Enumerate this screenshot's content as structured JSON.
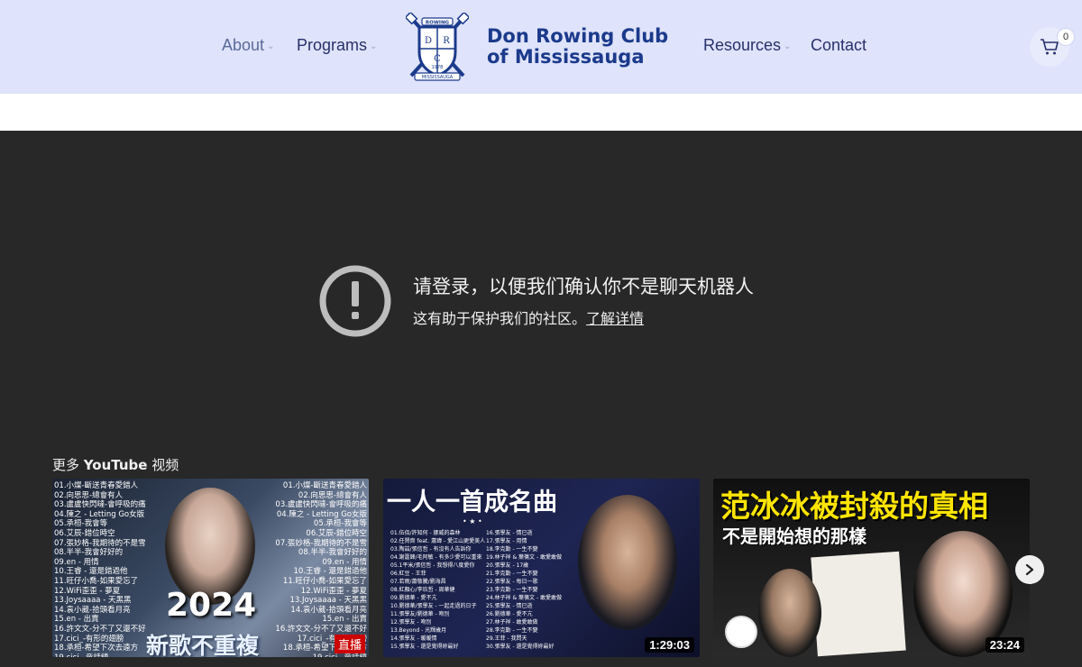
{
  "nav": {
    "about": "About",
    "programs": "Programs",
    "resources": "Resources",
    "contact": "Contact",
    "logo_line1": "Don Rowing Club",
    "logo_line2": "of Mississauga",
    "crest_top": "ROWING",
    "crest_bottom": "MISSISSAUGA",
    "crest_year": "1978",
    "crest_letters": [
      "D",
      "R",
      "C"
    ],
    "cart_count": "0"
  },
  "video": {
    "alert_title": "请登录，以便我们确认你不是聊天机器人",
    "alert_sub": "这有助于保护我们的社区。",
    "alert_link": "了解详情",
    "more_prefix": "更多 ",
    "more_brand": "YouTube",
    "more_suffix": " 视频",
    "thumbs": [
      {
        "tracks_left": "01.小燦-斷送青春愛錯人\n02.向思思-總會有人\n03.盧盧快閃噠-會呼吸的痛\n04.陳之 - Letting Go女版\n05.承桓-我會等\n06.艾辰-錯位時空\n07.張妙格-我期待的不是雪\n08.半半-我會好好的\n09.en - 用情\n10.王睿 - 還是錯過他\n11.旺仔小喬-如果愛忘了\n12.WiFi歪歪 - 夢夏\n13.Joysaaaa - 天黑黑\n14.袁小葳-拾頭看月亮\n15.en - 出賣\n16.許文文-分不了又還不好\n17.cici_-有形的翅膀\n18.承桓-希望下次去遠方\n19.cici_-童話鎮\n20.下圍,路口",
        "tracks_right": "01.小燦-斷送青春愛錯人\n02.向思思-總會有人\n03.盧盧快閃噠-會呼吸的痛\n04.陳之 - Letting Go女版\n05.承桓-我會等\n06.艾辰-錯位時空\n07.張妙格-我期待的不是雪\n08.半半-我會好好的\n09.en - 用情\n10.王睿 - 還是錯過他\n11.旺仔小喬-如果愛忘了\n12.WiFi歪歪 - 夢夏\n13.Joysaaaa - 天黑黑\n14.袁小葳-拾頭看月亮\n15.en - 出賣\n16.許文文-分不了又還不好\n17.cici_-有形的翅膀\n18.承桓-希望下次去遠方\n19.cici_-童話鎮\n20.下圍,路口",
        "year": "2024",
        "caption": "新歌不重複",
        "badge": "直播"
      },
      {
        "title": "一人一首成名曲",
        "tracks_a": "01.伍佰/許知何 - 挪威的森林\n02.任賢齊 feat. 蕭瑋 - 愛江山更愛美人\n03.陶喆/張信哲 - 有沒有人告訴你\n04.謝霆鋒/毛阿敏 - 有多少愛可以重來\n05.1平米/張信哲 - 我想得八度愛你\n06.紅豆 - 王菲\n07.若雨/蕭敬騰/劉海昌\n08.紅顏心/李玖哲 - 周華健\n09.劉德華 - 愛不亢\n10.劉德華/張學友 - 一起走過的日子\n11.張學友/劉德華 - 吻別\n12.張學友 - 吻別\n13.Beyond - 光輝歲月\n14.張學友 - 暖暖情\n15.張學友 - 還是覺得妳最好",
        "tracks_b": "16.張學友 - 情已逝\n17.張學友 - 用情\n18.李克勤 - 一生不變\n19.林子祥 & 葉蒨文 - 敢愛敢做\n20.張學友 - 17歲\n21.李克勤 - 一生不變\n22.張學友 - 每日一歌\n23.李克勤 - 一生不變\n24.林子祥 & 葉蒨文 - 敢愛敢做\n25.張學友 - 情已逝\n26.劉德華 - 愛不亢\n27.林子祥 - 敢愛敢做\n28.李克勤 - 一生不變\n29.王菲 - 我問天\n30.張學友 - 還是覺得妳最好",
        "duration": "1:29:03"
      },
      {
        "title": "范冰冰被封殺的真相",
        "subtitle": "不是開始想的那樣",
        "duration": "23:24"
      }
    ]
  },
  "colors": {
    "header_bg": "#dfe3fb",
    "nav_text": "#27306b",
    "brand_blue": "#1b3a8c",
    "video_bg": "#282828",
    "live_red": "#cc0000",
    "thumb3_title": "#ffe500"
  },
  "icons": {
    "cart": "cart-icon",
    "alert": "exclamation-circle-icon",
    "next": "chevron-right-icon"
  }
}
